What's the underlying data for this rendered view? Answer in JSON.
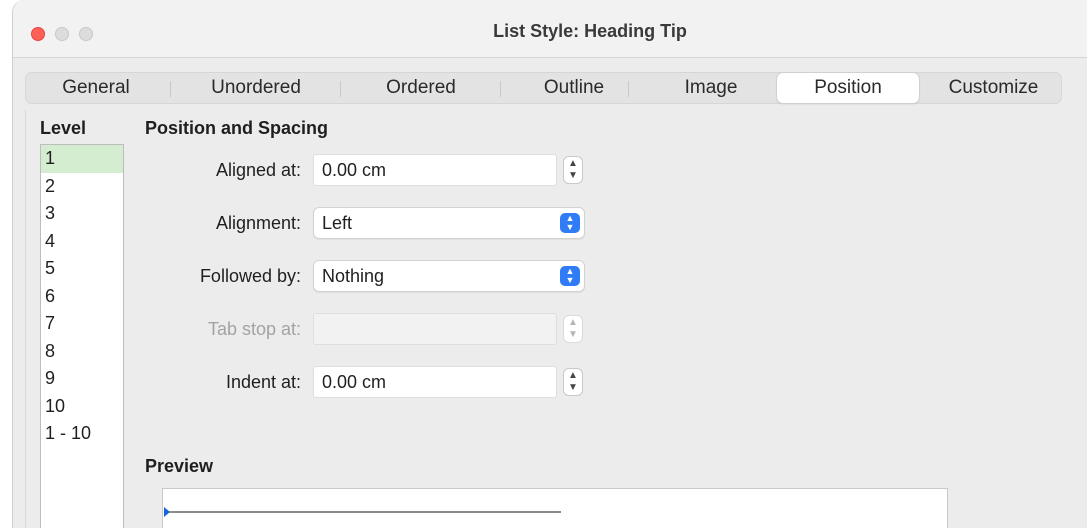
{
  "window": {
    "title": "List Style: Heading Tip"
  },
  "tabs": [
    {
      "label": "General"
    },
    {
      "label": "Unordered"
    },
    {
      "label": "Ordered"
    },
    {
      "label": "Outline"
    },
    {
      "label": "Image"
    },
    {
      "label": "Position",
      "active": true
    },
    {
      "label": "Customize"
    }
  ],
  "level": {
    "heading": "Level",
    "items": [
      "1",
      "2",
      "3",
      "4",
      "5",
      "6",
      "7",
      "8",
      "9",
      "10",
      "1 - 10"
    ],
    "selected": "1"
  },
  "position_spacing": {
    "heading": "Position and Spacing",
    "aligned_at": {
      "label": "Aligned at:",
      "value": "0.00 cm"
    },
    "alignment": {
      "label": "Alignment:",
      "value": "Left"
    },
    "followed_by": {
      "label": "Followed by:",
      "value": "Nothing"
    },
    "tab_stop_at": {
      "label": "Tab stop at:",
      "value": "",
      "disabled": true
    },
    "indent_at": {
      "label": "Indent at:",
      "value": "0.00 cm"
    }
  },
  "preview": {
    "heading": "Preview"
  },
  "colors": {
    "accent": "#2f7cf6",
    "selected_row": "#d4ecd0",
    "close_button": "#ff5f57"
  }
}
